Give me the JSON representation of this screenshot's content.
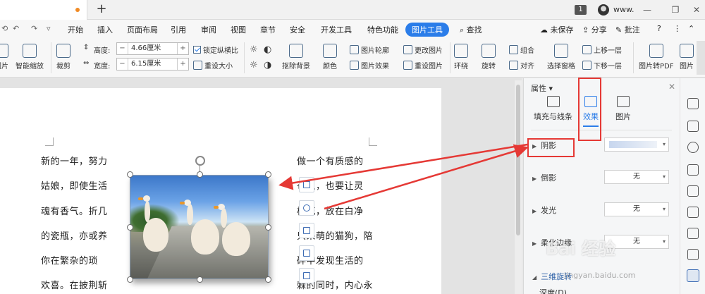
{
  "titlebar": {
    "new_tab_symbol": "+",
    "count_badge": "1",
    "user_name": "www.",
    "win_controls": [
      "—",
      "❐",
      "✕"
    ]
  },
  "menubar": {
    "items": [
      "开始",
      "插入",
      "页面布局",
      "引用",
      "审阅",
      "视图",
      "章节",
      "安全",
      "开发工具",
      "特色功能",
      "图片工具"
    ],
    "active": "图片工具",
    "search_label": "查找",
    "unsaved_label": "未保存",
    "share_label": "分享",
    "comment_label": "批注",
    "help_label": "?",
    "accent_color": "#2b7de9"
  },
  "ribbon": {
    "partial_left_label": "图片",
    "smart_zoom_label": "智能缩放",
    "crop_label": "裁剪",
    "height_label": "高度:",
    "height_value": "4.66厘米",
    "width_label": "宽度:",
    "width_value": "6.15厘米",
    "lock_ratio_label": "锁定纵横比",
    "reset_size_label": "重设大小",
    "remove_bg_label": "抠除背景",
    "color_label": "颜色",
    "outline_label": "图片轮廓",
    "effect_label": "图片效果",
    "change_pic_label": "更改图片",
    "reset_pic_label": "重设图片",
    "wrap_label": "环绕",
    "rotate_label": "旋转",
    "group_label": "组合",
    "align_label": "对齐",
    "selection_pane_label": "选择窗格",
    "bring_forward_label": "上移一层",
    "send_backward_label": "下移一层",
    "to_pdf_label": "图片转PDF",
    "partial_right_label": "图片"
  },
  "document": {
    "left_lines": [
      "新的一年，努力",
      "姑娘，即使生活",
      "魂有香气。折几",
      "的瓷瓶，亦或养",
      "你在繁杂的琐",
      "欢喜。在披荆斩"
    ],
    "right_lines": [
      "做一个有质感的",
      "苟且，也要让灵",
      "枝花，放在白净",
      "只呆萌的猫狗，陪",
      "碎中发现生活的",
      "棘的同时，内心永"
    ],
    "right_line_marks": [
      "",
      "着",
      "花",
      "头",
      "碎",
      "棘"
    ]
  },
  "pane": {
    "title": "属性",
    "tabs": [
      "填充与线条",
      "效果",
      "图片"
    ],
    "active_tab": "效果",
    "rows": [
      {
        "label": "阴影",
        "value": ""
      },
      {
        "label": "倒影",
        "value": "无"
      },
      {
        "label": "发光",
        "value": "无"
      },
      {
        "label": "柔化边缘",
        "value": "无"
      },
      {
        "label": "三维旋转",
        "value": ""
      },
      {
        "label": "深度(D)",
        "value": ""
      }
    ]
  },
  "watermark": {
    "text": "Bai 经验",
    "url": "jingyan.baidu.com"
  },
  "colors": {
    "annotation_red": "#e53935",
    "pane_bg": "#f5f6f7"
  }
}
